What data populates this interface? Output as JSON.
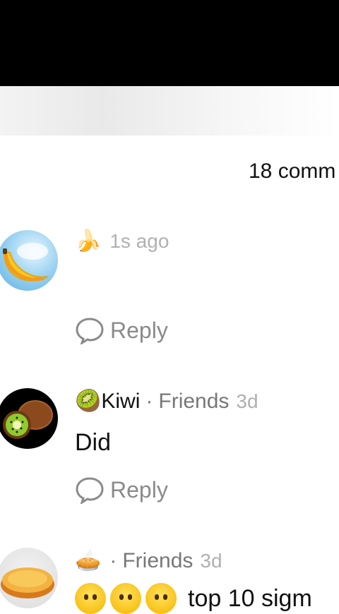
{
  "header": {
    "comment_count": "18 comm"
  },
  "comments": [
    {
      "avatar": "banana-avatar",
      "name_emoji": "🍌",
      "name": "",
      "tag": "",
      "time": "1s ago",
      "text": "",
      "reply_label": "Reply"
    },
    {
      "avatar": "kiwi-avatar",
      "name_emoji": "🥝",
      "name": "Kiwi",
      "separator": "·",
      "tag": "Friends",
      "time": "3d",
      "text": "Did",
      "reply_label": "Reply"
    },
    {
      "avatar": "pie-avatar",
      "name_emoji": "🥧",
      "name": "",
      "separator": "·",
      "tag": "Friends",
      "time": "3d",
      "text": "top 10 sigm",
      "reply_label": ""
    }
  ],
  "colors": {
    "muted": "#777777",
    "faint": "#b0b0b0",
    "reply": "#8a8a8a"
  }
}
